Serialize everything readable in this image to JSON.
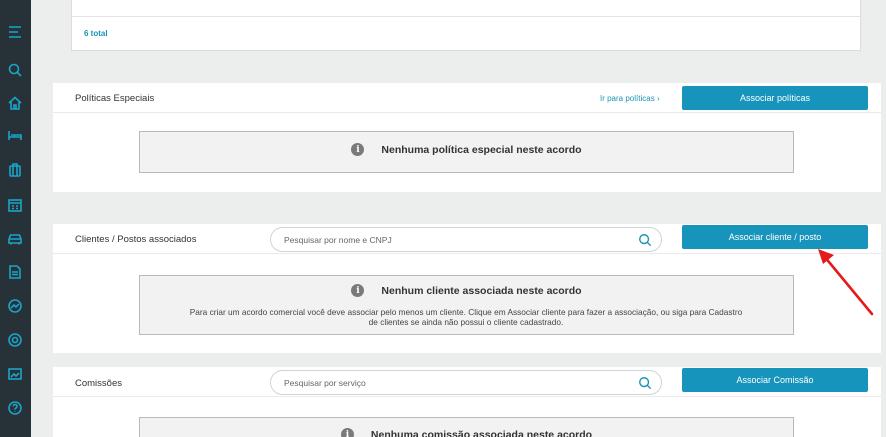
{
  "sidebar": {
    "icons": [
      "menu-icon",
      "search-icon",
      "home-icon",
      "bed-icon",
      "luggage-icon",
      "calendar-icon",
      "car-icon",
      "document-icon",
      "chart-icon",
      "at-icon",
      "report-icon",
      "help-icon"
    ]
  },
  "top_section": {
    "total": "6 total"
  },
  "politicas": {
    "title": "Políticas Especiais",
    "link": "Ir para políticas",
    "button": "Associar políticas",
    "empty_message": "Nenhuma política especial neste acordo"
  },
  "clientes": {
    "title": "Clientes / Postos associados",
    "search_placeholder": "Pesquisar por nome e CNPJ",
    "button": "Associar cliente / posto",
    "empty_title": "Nenhum cliente associada neste acordo",
    "empty_line1": "Para criar um acordo comercial você deve associar pelo menos um cliente. Clique em Associar cliente para fazer a associação, ou siga para Cadastro",
    "empty_line2": "de clientes se ainda não possui o cliente cadastrado."
  },
  "comissoes": {
    "title": "Comissões",
    "search_placeholder": "Pesquisar por serviço",
    "button": "Associar Comissão",
    "empty_message": "Nenhuma comissão associada neste acordo"
  },
  "colors": {
    "accent": "#1694bb",
    "sidebar": "#273238",
    "annotation": "#e31b1b"
  }
}
